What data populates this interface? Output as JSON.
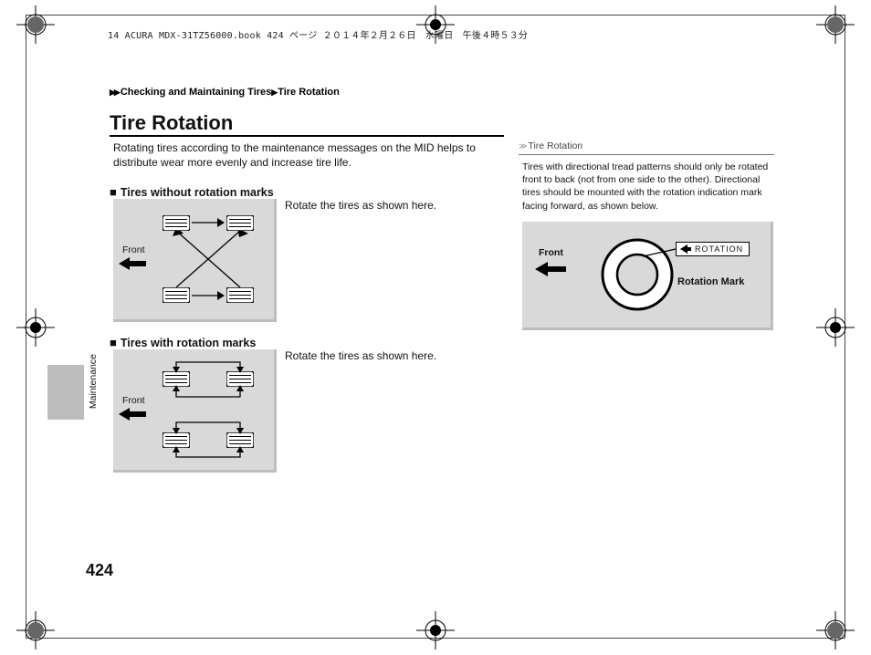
{
  "doc_info": "14 ACURA MDX-31TZ56000.book  424 ページ  ２０１４年２月２６日　水曜日　午後４時５３分",
  "breadcrumb": {
    "arrow": "▶▶",
    "part1": "Checking and Maintaining Tires",
    "sep": "▶",
    "part2": "Tire Rotation"
  },
  "title": "Tire Rotation",
  "intro": "Rotating tires according to the maintenance messages on the MID helps to distribute wear more evenly and increase tire life.",
  "sub1": "Tires without rotation marks",
  "sub2": "Tires with rotation marks",
  "caption1": "Rotate the tires as shown here.",
  "caption2": "Rotate the tires as shown here.",
  "front_label": "Front",
  "section_tab": "Maintenance",
  "page_number": "424",
  "sidebox": {
    "head_arrow": "≫",
    "head": "Tire Rotation",
    "body": "Tires with directional tread patterns should only be rotated front to back (not from one side to the other). Directional tires should be mounted with the rotation indication mark facing forward, as shown below.",
    "rotation_label": "ROTATION",
    "rotation_mark": "Rotation Mark"
  }
}
